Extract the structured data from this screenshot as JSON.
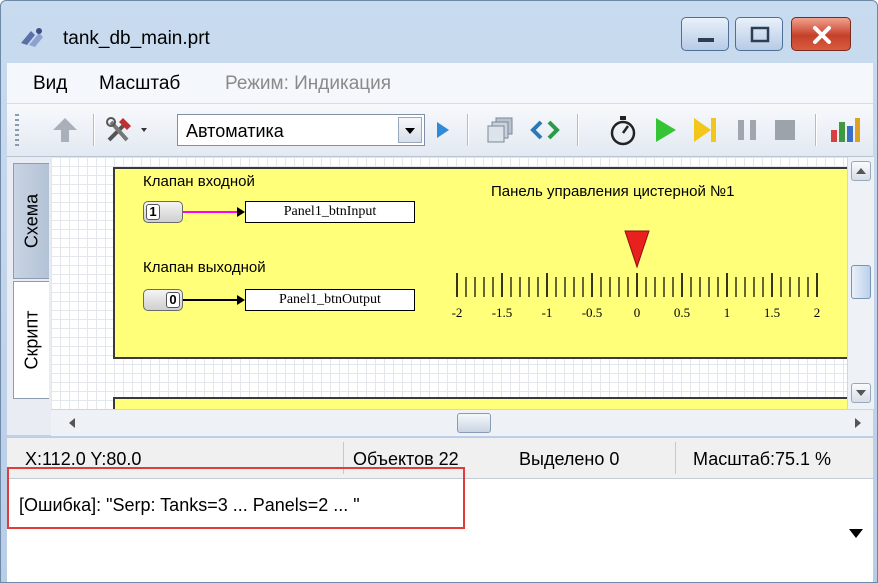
{
  "window": {
    "title": "tank_db_main.prt"
  },
  "menu": {
    "items": [
      {
        "label": "Вид",
        "enabled": true
      },
      {
        "label": "Масштаб",
        "enabled": true
      },
      {
        "label": "Режим: Индикация",
        "enabled": false
      }
    ]
  },
  "toolbar": {
    "mode_combo": {
      "value": "Автоматика"
    }
  },
  "tabs": {
    "schema": "Схема",
    "script": "Скрипт"
  },
  "panel": {
    "title": "Панель управления цистерной №1",
    "valve_input_label": "Клапан входной",
    "valve_output_label": "Клапан выходной",
    "input_toggle_value": "1",
    "output_toggle_value": "0",
    "input_tag": "Panel1_btnInput",
    "output_tag": "Panel1_btnOutput",
    "scale": {
      "min": -2,
      "max": 2,
      "labels": [
        "-2",
        "-1.5",
        "-1",
        "-0.5",
        "0",
        "0.5",
        "1",
        "1.5",
        "2"
      ],
      "pointer_value": 0
    }
  },
  "status": {
    "coords": "X:112.0  Y:80.0",
    "objects": "Объектов 22",
    "selected": "Выделено 0",
    "zoom": "Масштаб:75.1 %"
  },
  "log": {
    "message": "[Ошибка]:  \"Serp:  Tanks=3 ... Panels=2 ... \""
  },
  "colors": {
    "panel_fill": "#ffff7a",
    "highlight": "#e23b3b",
    "input_link": "#ff00ff",
    "pointer": "#e8201e"
  }
}
